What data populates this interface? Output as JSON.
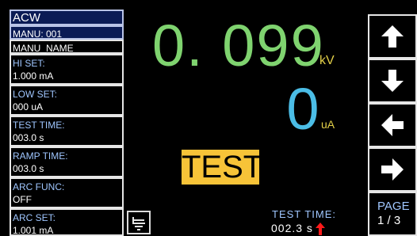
{
  "mode": "ACW",
  "manu": {
    "number": "MANU: 001",
    "name": "MANU_NAME"
  },
  "settings": [
    {
      "title": "HI SET:",
      "value": "1.000 mA"
    },
    {
      "title": "LOW SET:",
      "value": "000 uA"
    },
    {
      "title": "TEST TIME:",
      "value": "003.0 s"
    },
    {
      "title": "RAMP TIME:",
      "value": "003.0 s"
    },
    {
      "title": "ARC FUNC:",
      "value": "OFF"
    },
    {
      "title": "ARC SET:",
      "value": "1.001 mA"
    }
  ],
  "readout": {
    "voltage": "0. 099",
    "voltage_unit": "kV",
    "current": "0",
    "current_unit": "uA"
  },
  "status": "TEST",
  "test_time": {
    "title": "TEST TIME:",
    "value": "002.3 s"
  },
  "softkeys": {
    "keys": [
      "arrow-up-icon",
      "arrow-down-icon",
      "arrow-left-icon",
      "arrow-right-icon"
    ],
    "page_label": "PAGE",
    "page_num": "1 / 3"
  },
  "colors": {
    "voltage": "#7fd36f",
    "current": "#4bbde6",
    "unit": "#e2cf48",
    "badge": "#f7c338",
    "title_text": "#9fc6ff"
  }
}
